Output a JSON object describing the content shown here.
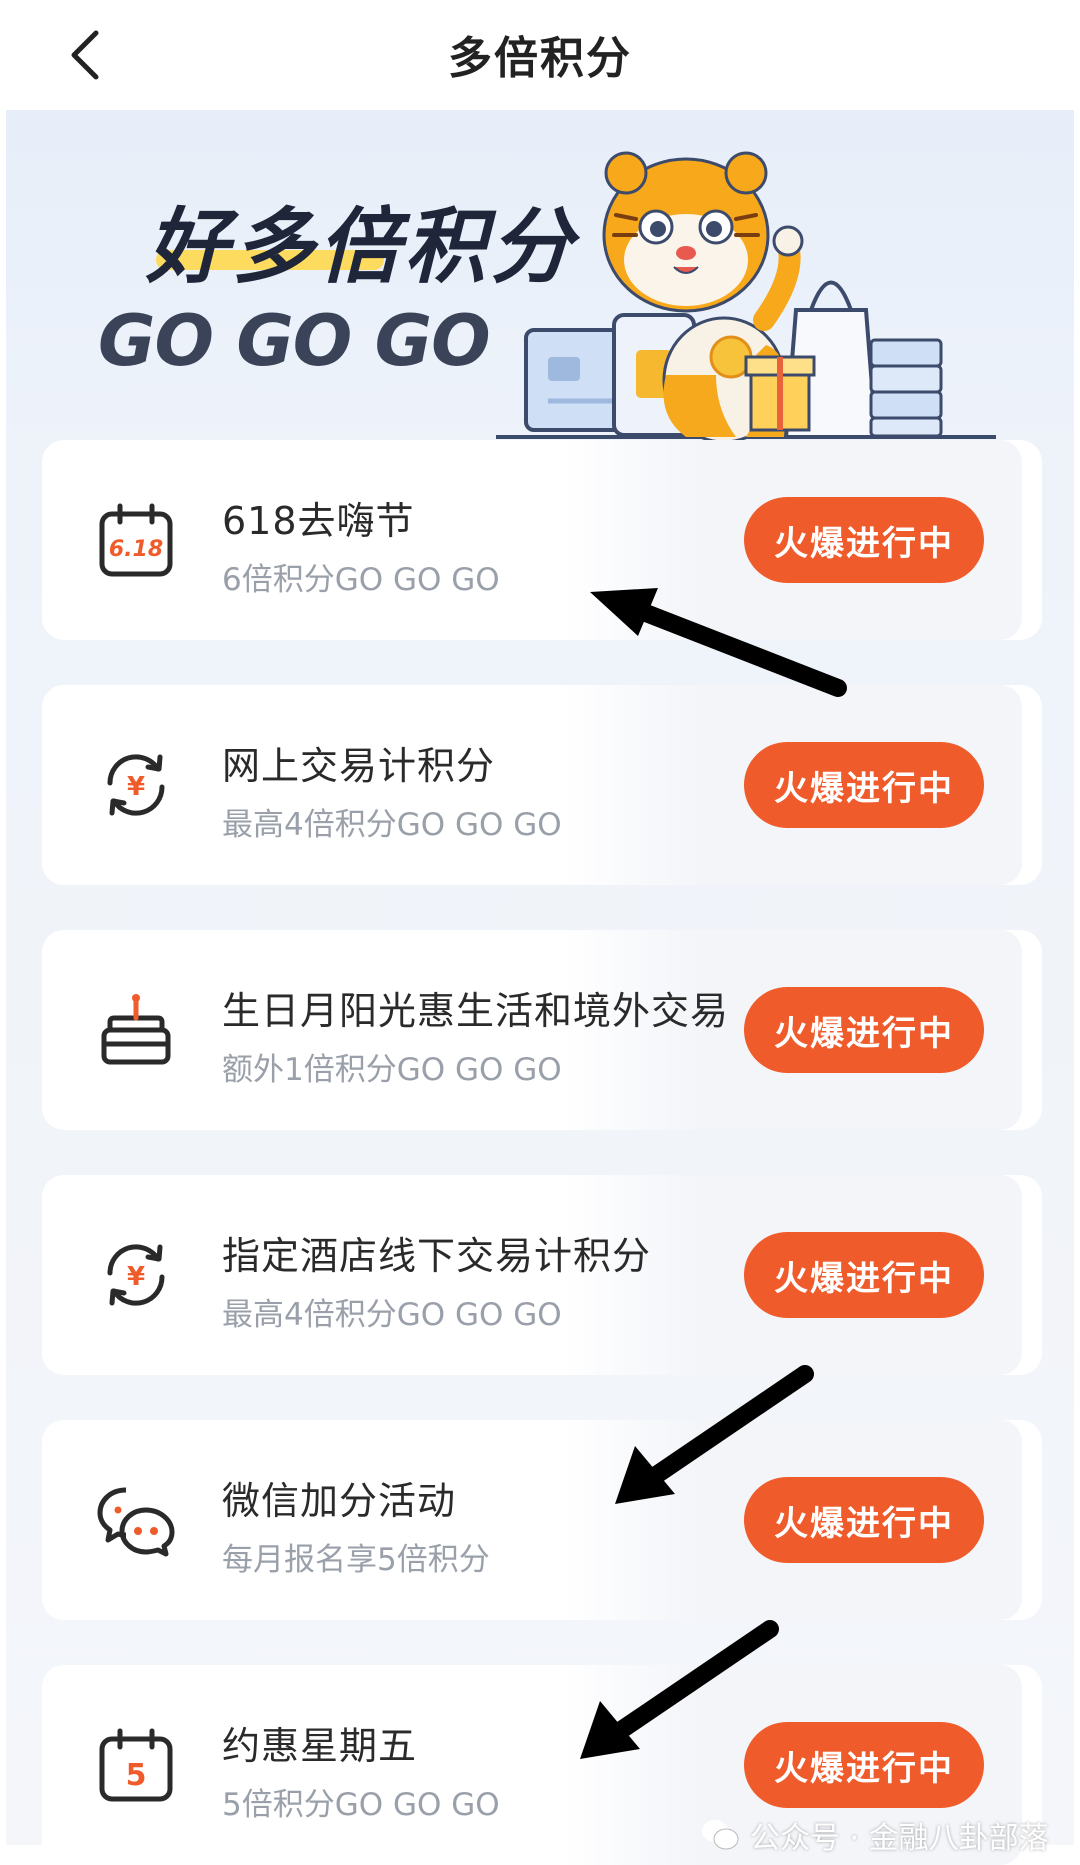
{
  "navbar": {
    "title": "多倍积分"
  },
  "hero": {
    "title": "好多倍积分",
    "subtitle": "GO GO GO"
  },
  "activities": [
    {
      "icon": "calendar-618-icon",
      "icon_text": "6.18",
      "title": "618去嗨节",
      "subtitle": "6倍积分GO GO GO",
      "status": "火爆进行中"
    },
    {
      "icon": "yuan-exchange-icon",
      "title": "网上交易计积分",
      "subtitle": "最高4倍积分GO GO GO",
      "status": "火爆进行中"
    },
    {
      "icon": "birthday-cake-icon",
      "title": "生日月阳光惠生活和境外交易",
      "subtitle": "额外1倍积分GO GO GO",
      "status": "火爆进行中"
    },
    {
      "icon": "yuan-exchange-icon",
      "title": "指定酒店线下交易计积分",
      "subtitle": "最高4倍积分GO GO GO",
      "status": "火爆进行中"
    },
    {
      "icon": "wechat-chat-icon",
      "title": "微信加分活动",
      "subtitle": "每月报名享5倍积分",
      "status": "火爆进行中"
    },
    {
      "icon": "calendar-5-icon",
      "icon_text": "5",
      "title": "约惠星期五",
      "subtitle": "5倍积分GO GO GO",
      "status": "火爆进行中"
    }
  ],
  "watermark": {
    "text": "公众号 · 金融八卦部落"
  },
  "colors": {
    "accent": "#ef5b2b",
    "title": "#20263a",
    "highlight": "#ffd84d"
  }
}
